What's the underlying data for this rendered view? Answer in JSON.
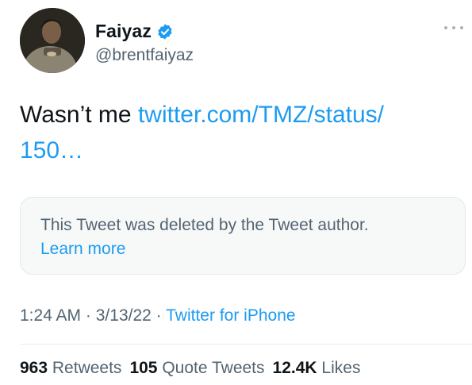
{
  "author": {
    "name": "Faiyaz",
    "handle": "@brentfaiyaz",
    "verified_icon": "verified-badge-icon"
  },
  "tweet": {
    "text": "Wasn’t me",
    "link_line1": "twitter.com/TMZ/status/",
    "link_line2": "150…"
  },
  "quoted": {
    "deleted_message": "This Tweet was deleted by the Tweet author.",
    "learn_more": "Learn more"
  },
  "meta": {
    "time": "1:24 AM",
    "separator": "·",
    "date": "3/13/22",
    "source": "Twitter for iPhone"
  },
  "stats": {
    "retweets_count": "963",
    "retweets_label": "Retweets",
    "quotes_count": "105",
    "quotes_label": "Quote Tweets",
    "likes_count": "12.4K",
    "likes_label": "Likes"
  },
  "colors": {
    "text": "#0f1419",
    "secondary": "#536471",
    "link": "#1d9bf0",
    "card_bg": "#f7f9f9"
  }
}
